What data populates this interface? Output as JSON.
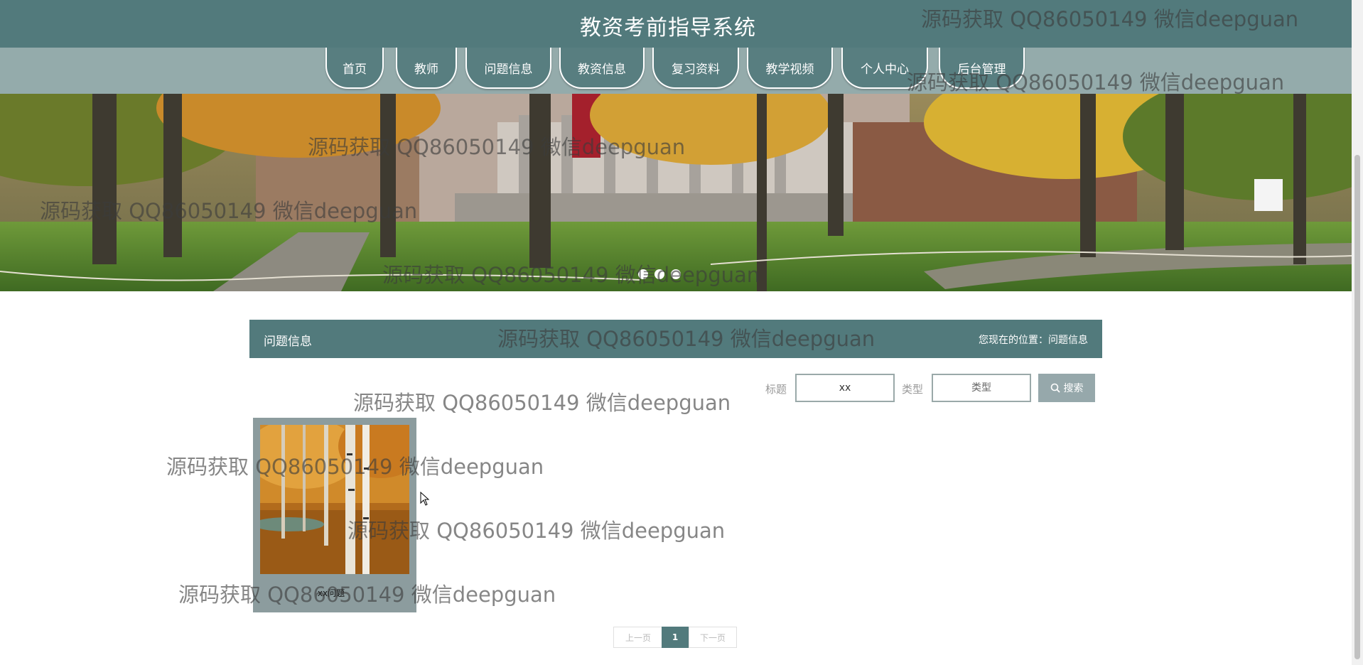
{
  "header": {
    "title": "教资考前指导系统"
  },
  "nav": {
    "items": [
      {
        "label": "首页"
      },
      {
        "label": "教师"
      },
      {
        "label": "问题信息"
      },
      {
        "label": "教资信息"
      },
      {
        "label": "复习资料"
      },
      {
        "label": "教学视频"
      },
      {
        "label": "个人中心"
      },
      {
        "label": "后台管理"
      }
    ]
  },
  "section": {
    "title": "问题信息",
    "location": "您现在的位置：问题信息"
  },
  "search": {
    "title_label": "标题",
    "title_value": "xx",
    "type_label": "类型",
    "type_placeholder": "类型",
    "button_label": "搜索"
  },
  "cards": [
    {
      "title": "xx问题"
    }
  ],
  "pagination": {
    "prev": "上一页",
    "current": "1",
    "next": "下一页"
  },
  "watermark": "源码获取 QQ86050149 微信deepguan",
  "icons": {
    "search": "search-icon",
    "cursor": "mouse-cursor-icon"
  },
  "colors": {
    "primary": "#527a7c",
    "nav_bar": "#94abab",
    "card_bg": "#8c9c9e",
    "search_button": "#96a8ab"
  }
}
